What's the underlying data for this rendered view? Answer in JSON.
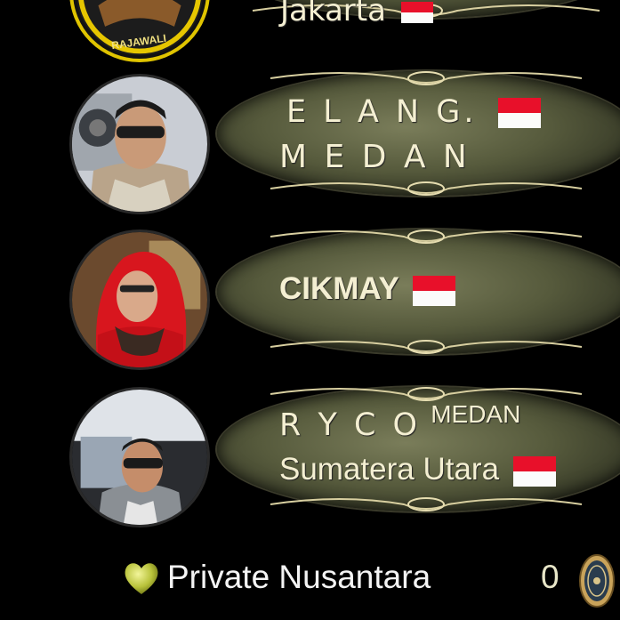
{
  "rows": [
    {
      "id": "top-partial",
      "line1": "Jakarta",
      "avatar_caption": "RAJAWALI",
      "has_flag": true
    },
    {
      "id": "elang-medan",
      "line1": "E L A N G.",
      "line2": "M E D A N",
      "has_flag": true
    },
    {
      "id": "cikmay",
      "line1": "CIKMAY",
      "has_flag": true
    },
    {
      "id": "ryco",
      "line1": "R  Y  C  O",
      "line1_super": "MEDAN",
      "line2": "Sumatera  Utara",
      "has_flag": true
    }
  ],
  "footer": {
    "icon": "green-heart-icon",
    "name": "Private Nusantara",
    "count": "0",
    "badge_icon": "medal-badge-icon"
  },
  "colors": {
    "banner": "#565a3c",
    "banner_text": "#f4efd2",
    "flag_red": "#e8102a",
    "heart": "#b8c23a",
    "background": "#000000"
  }
}
